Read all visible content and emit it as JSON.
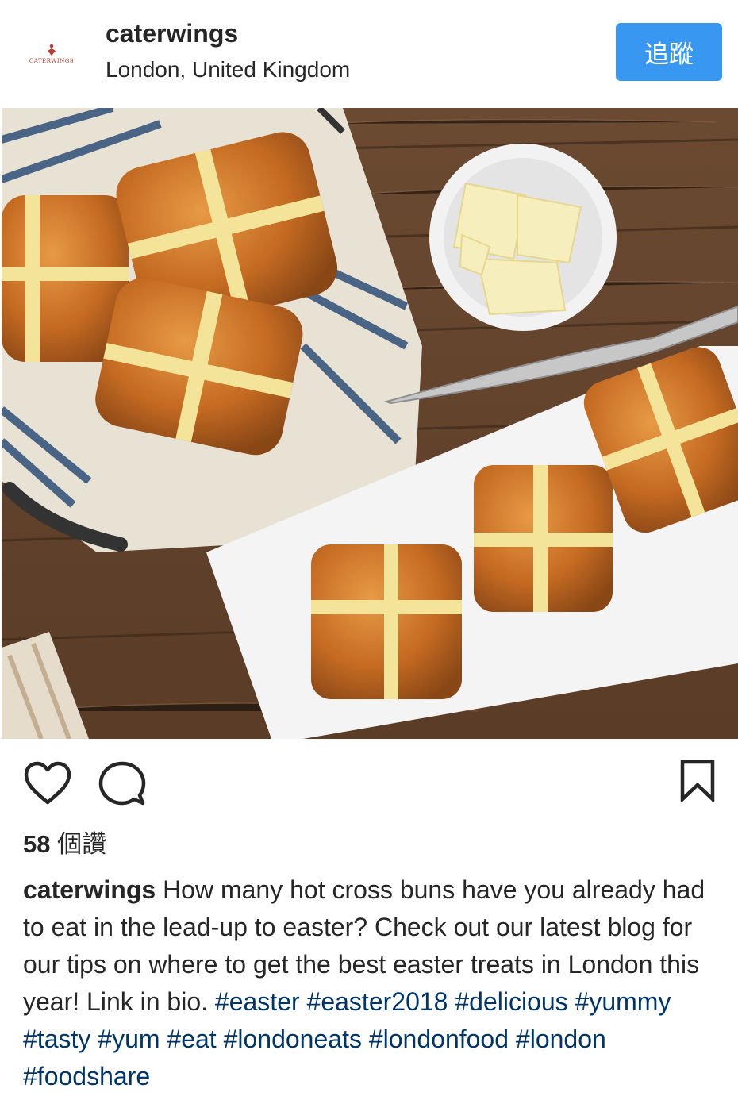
{
  "post": {
    "username": "caterwings",
    "location": "London, United Kingdom",
    "avatar_text": "CATERWINGS",
    "follow_label": "追蹤",
    "likes_count": "58",
    "likes_suffix": " 個讚",
    "caption_username": "caterwings",
    "caption_text": " How many hot cross buns have you already had to eat in the lead-up to easter? Check out our latest blog for our tips on where to get the best easter treats in London this year! Link in bio. ",
    "hashtags": [
      "#easter",
      "#easter2018",
      "#delicious",
      "#yummy",
      "#tasty",
      "#yum",
      "#eat",
      "#londoneats",
      "#londonfood",
      "#london",
      "#foodshare"
    ]
  },
  "icons": {
    "like": "heart-icon",
    "comment": "comment-icon",
    "save": "bookmark-icon"
  },
  "colors": {
    "follow_button": "#3897f0",
    "hashtag": "#003569",
    "text": "#262626"
  }
}
